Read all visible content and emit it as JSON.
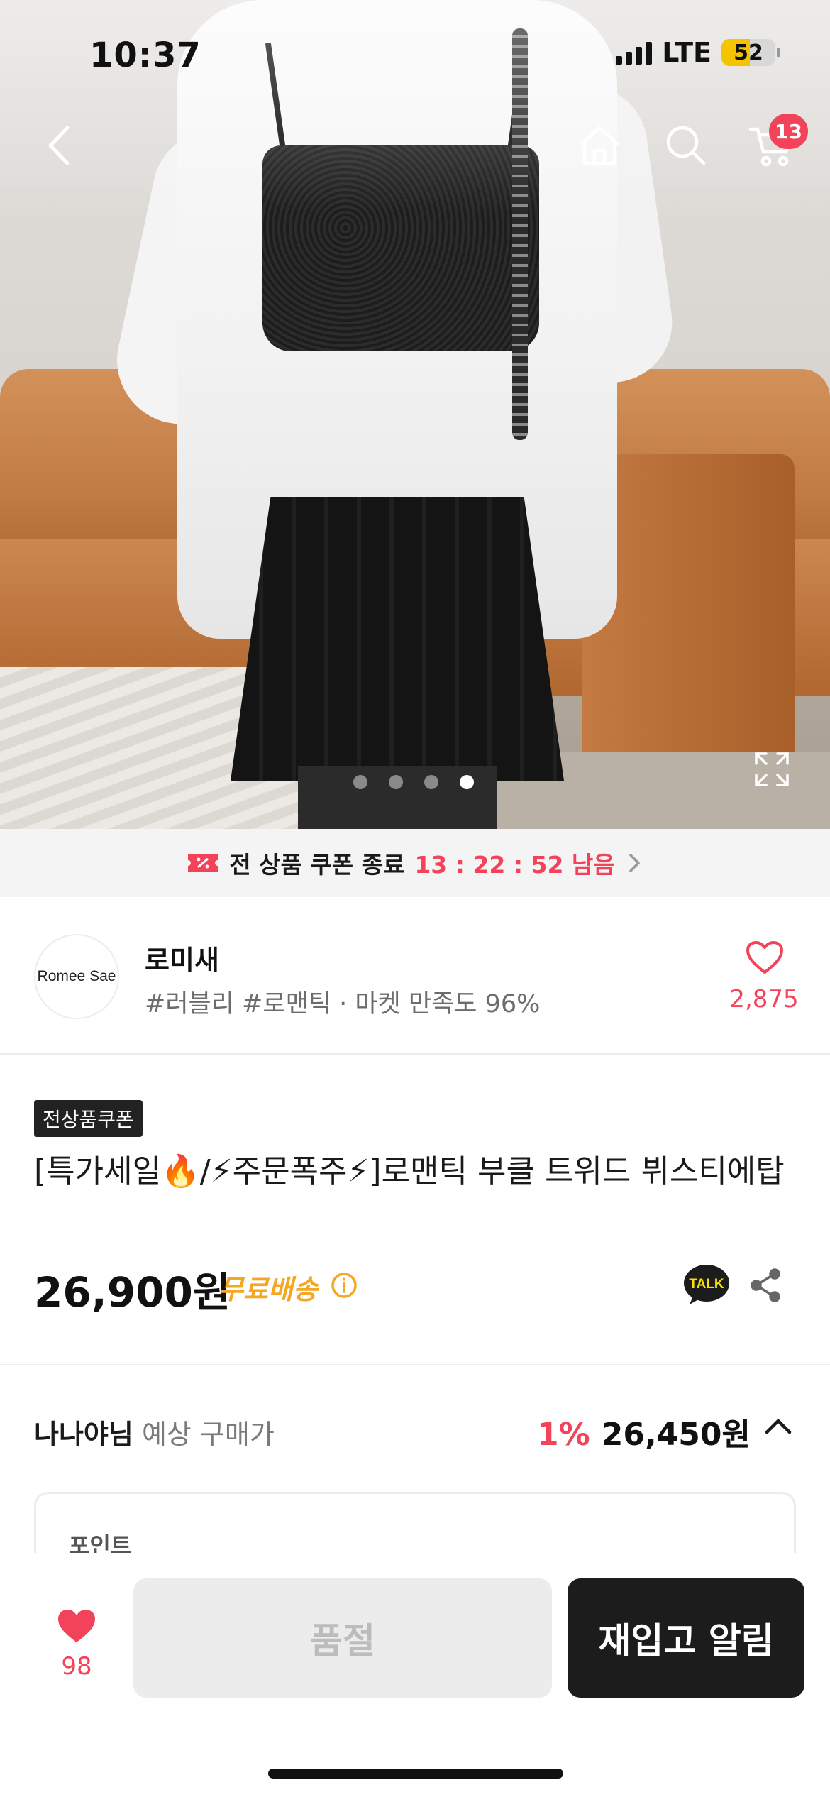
{
  "status_bar": {
    "time": "10:37",
    "network": "LTE",
    "battery": "52"
  },
  "nav": {
    "cart_count": "13"
  },
  "carousel": {
    "count": 4,
    "active_index": 3
  },
  "coupon_bar": {
    "text": "전 상품 쿠폰 종료",
    "timer": "13 : 22 : 52 남음"
  },
  "shop": {
    "logo_text": "Romee Sae",
    "name": "로미새",
    "tags": "#러블리 #로맨틱 · 마켓 만족도 96%",
    "likes": "2,875"
  },
  "product": {
    "badge": "전상품쿠폰",
    "title": "[특가세일🔥/⚡주문폭주⚡]로맨틱 부클 트위드 뷔스티에탑",
    "price": "26,900원",
    "shipping": "무료배송"
  },
  "estimate": {
    "user": "나나야님",
    "label": "예상 구매가",
    "discount": "1%",
    "price": "26,450원"
  },
  "points": {
    "label": "포인트"
  },
  "bottom": {
    "wish_count": "98",
    "soldout_label": "품절",
    "restock_label": "재입고 알림"
  },
  "colors": {
    "accent": "#f2435b",
    "shipping": "#f5a623",
    "dark": "#1c1c1c"
  }
}
